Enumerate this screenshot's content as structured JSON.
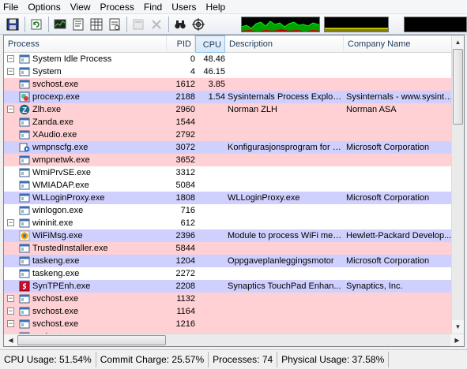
{
  "menu": [
    "File",
    "Options",
    "View",
    "Process",
    "Find",
    "Users",
    "Help"
  ],
  "toolbar": {
    "icons": [
      "save-icon",
      "refresh-icon",
      "system-info-icon",
      "properties-icon",
      "tree-view-icon",
      "dll-view-icon",
      "kill-process-icon",
      "close-handle-icon",
      "find-icon",
      "target-icon"
    ]
  },
  "columns": {
    "process": "Process",
    "pid": "PID",
    "cpu": "CPU",
    "description": "Description",
    "company": "Company Name"
  },
  "colors": {
    "service_row": "#ffd0d4",
    "own_process_row": "#d0d0ff",
    "normal_row": "#ffffff",
    "graph_cpu": "#00d000",
    "graph_commit": "#ffff00",
    "graph_io": "#e00000"
  },
  "rows": [
    {
      "name": "System Idle Process",
      "pid": "0",
      "cpu": "48.46",
      "desc": "",
      "company": "",
      "color": "normal",
      "expander": "−",
      "icon": "window-icon"
    },
    {
      "name": "System",
      "pid": "4",
      "cpu": "46.15",
      "desc": "",
      "company": "",
      "color": "normal",
      "expander": "−",
      "icon": "window-icon"
    },
    {
      "name": "svchost.exe",
      "pid": "1612",
      "cpu": "3.85",
      "desc": "",
      "company": "",
      "color": "service",
      "expander": "",
      "icon": "window-icon"
    },
    {
      "name": "procexp.exe",
      "pid": "2188",
      "cpu": "1.54",
      "desc": "Sysinternals Process Explorer",
      "company": "Sysinternals - www.sysinter...",
      "color": "own",
      "expander": "",
      "icon": "procexp-icon"
    },
    {
      "name": "Zlh.exe",
      "pid": "2960",
      "cpu": "",
      "desc": "Norman ZLH",
      "company": "Norman ASA",
      "color": "service",
      "expander": "−",
      "icon": "norman-icon"
    },
    {
      "name": "Zanda.exe",
      "pid": "1544",
      "cpu": "",
      "desc": "",
      "company": "",
      "color": "service",
      "expander": "",
      "icon": "window-icon"
    },
    {
      "name": "XAudio.exe",
      "pid": "2792",
      "cpu": "",
      "desc": "",
      "company": "",
      "color": "service",
      "expander": "",
      "icon": "window-icon"
    },
    {
      "name": "wmpnscfg.exe",
      "pid": "3072",
      "cpu": "",
      "desc": "Konfigurasjonsprogram for W...",
      "company": "Microsoft Corporation",
      "color": "own",
      "expander": "",
      "icon": "media-icon"
    },
    {
      "name": "wmpnetwk.exe",
      "pid": "3652",
      "cpu": "",
      "desc": "",
      "company": "",
      "color": "service",
      "expander": "",
      "icon": "window-icon"
    },
    {
      "name": "WmiPrvSE.exe",
      "pid": "3312",
      "cpu": "",
      "desc": "",
      "company": "",
      "color": "normal",
      "expander": "",
      "icon": "window-icon"
    },
    {
      "name": "WMIADAP.exe",
      "pid": "5084",
      "cpu": "",
      "desc": "",
      "company": "",
      "color": "normal",
      "expander": "",
      "icon": "window-icon"
    },
    {
      "name": "WLLoginProxy.exe",
      "pid": "1808",
      "cpu": "",
      "desc": "WLLoginProxy.exe",
      "company": "Microsoft Corporation",
      "color": "own",
      "expander": "",
      "icon": "window-icon"
    },
    {
      "name": "winlogon.exe",
      "pid": "716",
      "cpu": "",
      "desc": "",
      "company": "",
      "color": "normal",
      "expander": "",
      "icon": "window-icon"
    },
    {
      "name": "wininit.exe",
      "pid": "612",
      "cpu": "",
      "desc": "",
      "company": "",
      "color": "normal",
      "expander": "−",
      "icon": "window-icon"
    },
    {
      "name": "WiFiMsg.exe",
      "pid": "2396",
      "cpu": "",
      "desc": "Module to process WiFi mes...",
      "company": "Hewlett-Packard Develop...",
      "color": "own",
      "expander": "",
      "icon": "wifi-icon"
    },
    {
      "name": "TrustedInstaller.exe",
      "pid": "5844",
      "cpu": "",
      "desc": "",
      "company": "",
      "color": "service",
      "expander": "",
      "icon": "window-icon"
    },
    {
      "name": "taskeng.exe",
      "pid": "1204",
      "cpu": "",
      "desc": "Oppgaveplanleggingsmotor",
      "company": "Microsoft Corporation",
      "color": "own",
      "expander": "",
      "icon": "window-icon"
    },
    {
      "name": "taskeng.exe",
      "pid": "2272",
      "cpu": "",
      "desc": "",
      "company": "",
      "color": "normal",
      "expander": "",
      "icon": "window-icon"
    },
    {
      "name": "SynTPEnh.exe",
      "pid": "2208",
      "cpu": "",
      "desc": "Synaptics TouchPad Enhan...",
      "company": "Synaptics, Inc.",
      "color": "own",
      "expander": "",
      "icon": "synaptics-icon"
    },
    {
      "name": "svchost.exe",
      "pid": "1132",
      "cpu": "",
      "desc": "",
      "company": "",
      "color": "service",
      "expander": "−",
      "icon": "window-icon"
    },
    {
      "name": "svchost.exe",
      "pid": "1164",
      "cpu": "",
      "desc": "",
      "company": "",
      "color": "service",
      "expander": "−",
      "icon": "window-icon"
    },
    {
      "name": "svchost.exe",
      "pid": "1216",
      "cpu": "",
      "desc": "",
      "company": "",
      "color": "service",
      "expander": "−",
      "icon": "window-icon"
    },
    {
      "name": "svchost.exe",
      "pid": "",
      "cpu": "",
      "desc": "",
      "company": "",
      "color": "service",
      "expander": "",
      "icon": "window-icon"
    }
  ],
  "status": {
    "cpu": "CPU Usage: 51.54%",
    "commit": "Commit Charge: 25.57%",
    "processes": "Processes: 74",
    "physical": "Physical Usage: 37.58%"
  }
}
